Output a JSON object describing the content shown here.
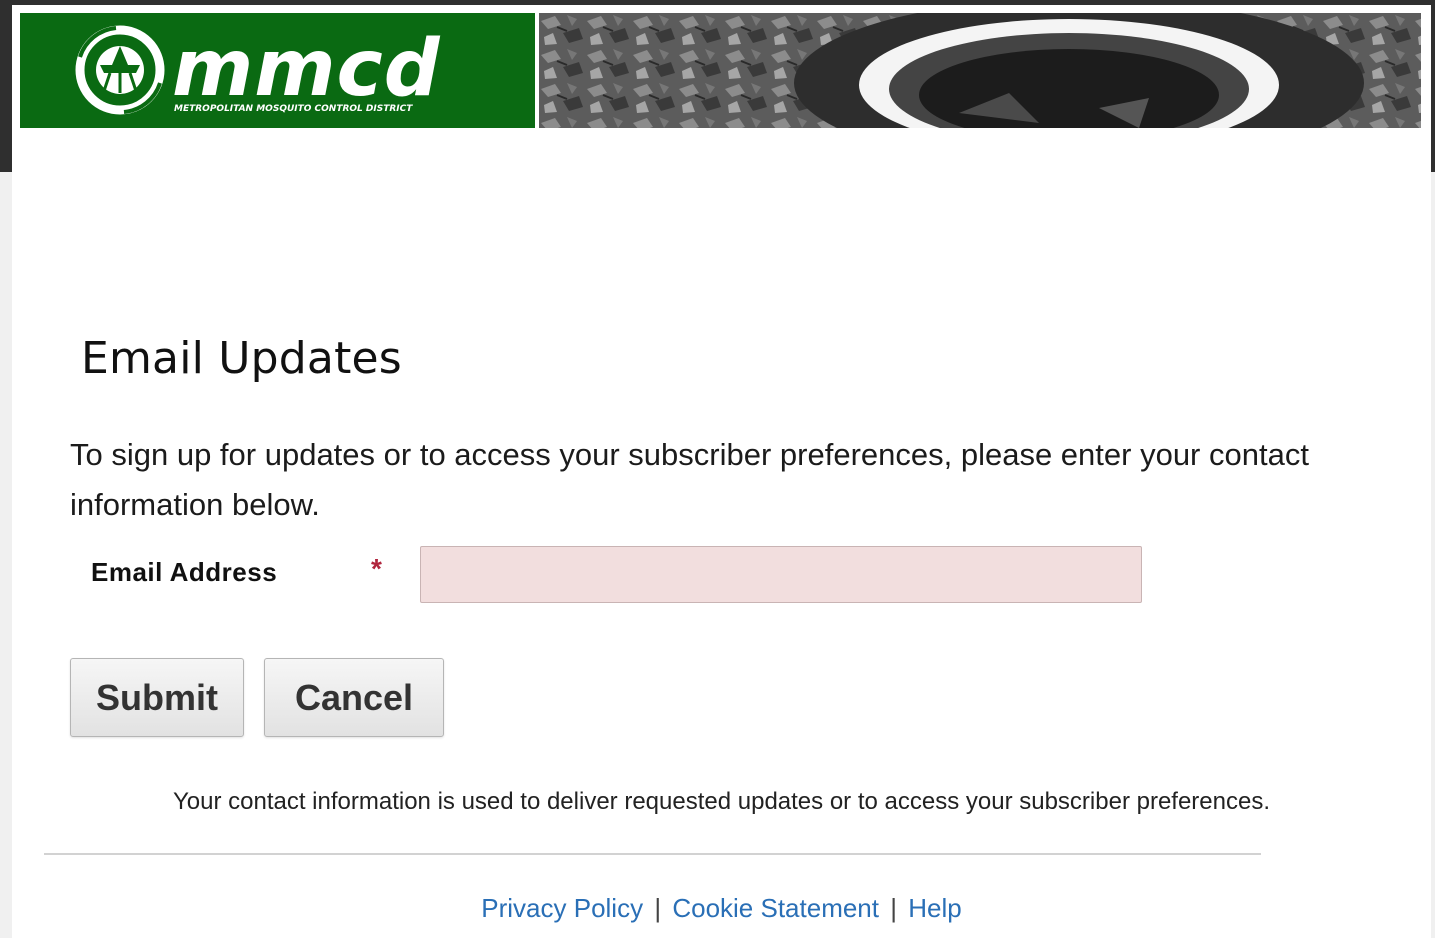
{
  "header": {
    "logo_wordmark": "mmcd",
    "logo_subtitle": "METROPOLITAN MOSQUITO CONTROL DISTRICT"
  },
  "main": {
    "title": "Email Updates",
    "intro": "To sign up for updates or to access your subscriber preferences, please enter your contact information below.",
    "email_label": "Email Address",
    "required_marker": "*",
    "email_value": "",
    "submit_label": "Submit",
    "cancel_label": "Cancel",
    "notice": "Your contact information is used to deliver requested updates or to access your subscriber preferences."
  },
  "footer": {
    "privacy": "Privacy Policy",
    "cookie": "Cookie Statement",
    "help": "Help",
    "separator": "|"
  },
  "colors": {
    "brand_green": "#0a6a12",
    "input_error_bg": "#f2dede",
    "required_red": "#b0253d",
    "link_blue": "#2a6fb6"
  }
}
